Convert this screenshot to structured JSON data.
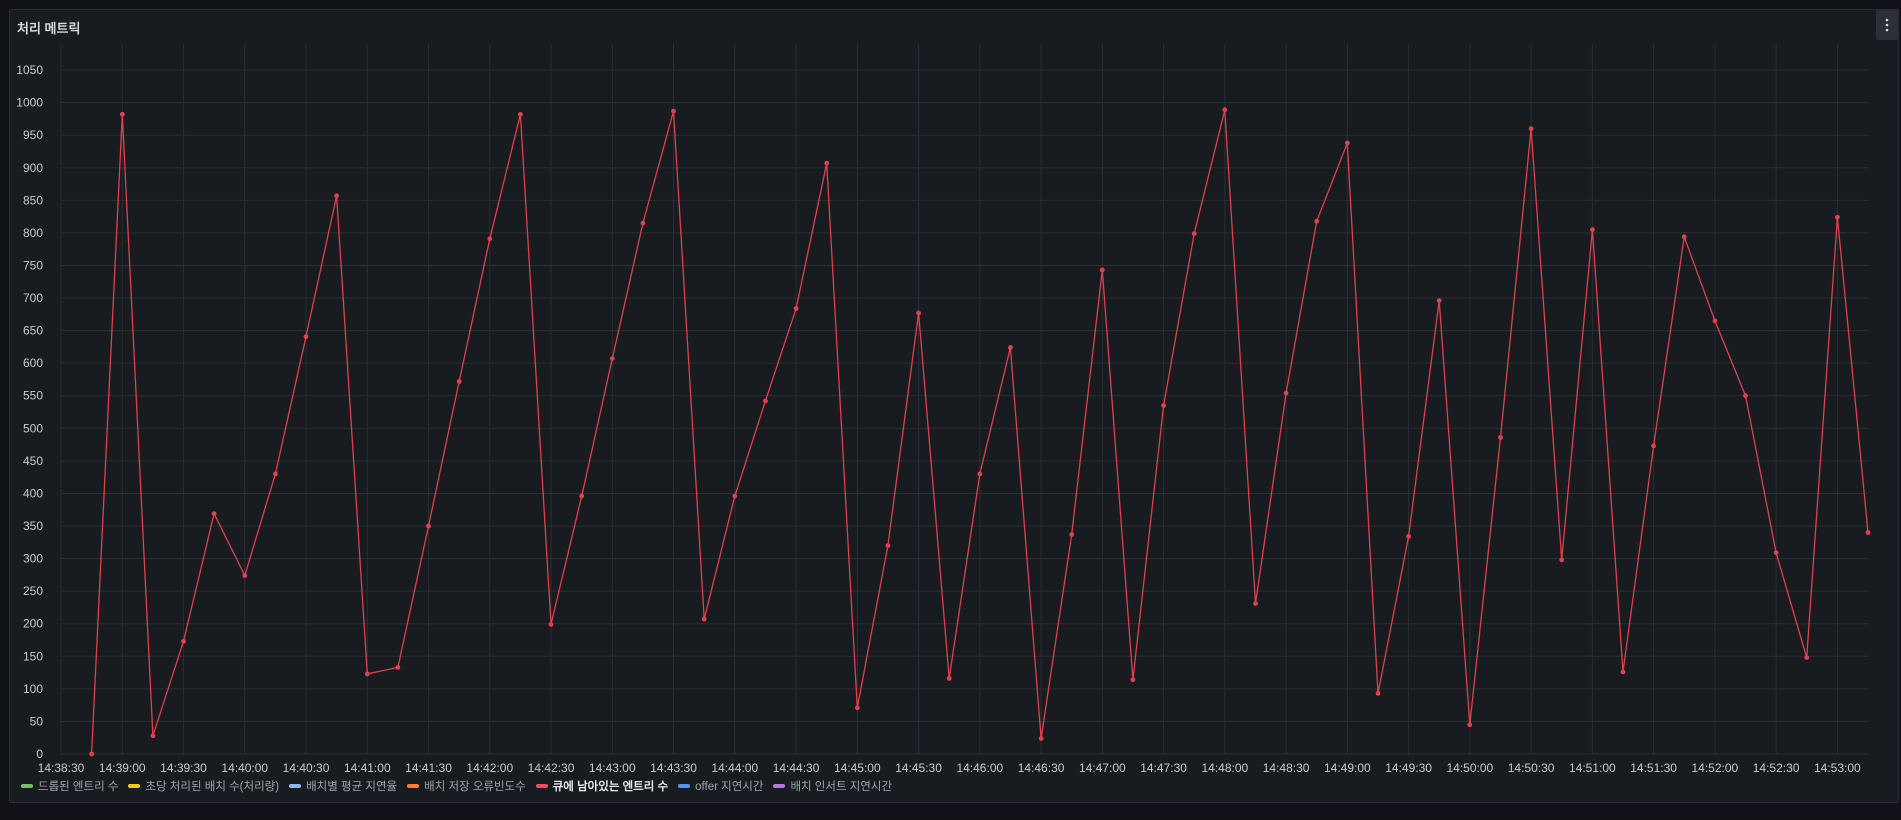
{
  "panel": {
    "title": "처리 메트릭"
  },
  "colors": {
    "line": "#e0414c",
    "grid": "#2b2e33",
    "axis_text": "#cccccc"
  },
  "legend": [
    {
      "label": "드롭된 엔트리 수",
      "color": "#73bf69",
      "active": false
    },
    {
      "label": "초당 처리된 배치 수(처리량)",
      "color": "#f2cc0c",
      "active": false
    },
    {
      "label": "배치별 평균 지연율",
      "color": "#8ab8ff",
      "active": false
    },
    {
      "label": "배치 저장 오류빈도수",
      "color": "#ff7a2e",
      "active": false
    },
    {
      "label": "큐에 남아있는 엔트리 수",
      "color": "#f2495c",
      "active": true
    },
    {
      "label": "offer 지연시간",
      "color": "#5794f2",
      "active": false
    },
    {
      "label": "배치 인서트 지연시간",
      "color": "#b877d9",
      "active": false
    }
  ],
  "chart_data": {
    "type": "line",
    "x_ticks": [
      "14:38:30",
      "14:39:00",
      "14:39:30",
      "14:40:00",
      "14:40:30",
      "14:41:00",
      "14:41:30",
      "14:42:00",
      "14:42:30",
      "14:43:00",
      "14:43:30",
      "14:44:00",
      "14:44:30",
      "14:45:00",
      "14:45:30",
      "14:46:00",
      "14:46:30",
      "14:47:00",
      "14:47:30",
      "14:48:00",
      "14:48:30",
      "14:49:00",
      "14:49:30",
      "14:50:00",
      "14:50:30",
      "14:51:00",
      "14:51:30",
      "14:52:00",
      "14:52:30",
      "14:53:00"
    ],
    "y_ticks": [
      0,
      50,
      100,
      150,
      200,
      250,
      300,
      350,
      400,
      450,
      500,
      550,
      600,
      650,
      700,
      750,
      800,
      850,
      900,
      950,
      1000,
      1050
    ],
    "xlim": [
      "14:38:30",
      "14:53:15"
    ],
    "ylim": [
      0,
      1090
    ],
    "grid": true,
    "legend_position": "bottom-left",
    "series": [
      {
        "name": "큐에 남아있는 엔트리 수",
        "color": "#e0414c",
        "x": [
          "14:38:45",
          "14:39:00",
          "14:39:15",
          "14:39:30",
          "14:39:45",
          "14:40:00",
          "14:40:15",
          "14:40:30",
          "14:40:45",
          "14:41:00",
          "14:41:15",
          "14:41:30",
          "14:41:45",
          "14:42:00",
          "14:42:15",
          "14:42:30",
          "14:42:45",
          "14:43:00",
          "14:43:15",
          "14:43:30",
          "14:43:45",
          "14:44:00",
          "14:44:15",
          "14:44:30",
          "14:44:45",
          "14:45:00",
          "14:45:15",
          "14:45:30",
          "14:45:45",
          "14:46:00",
          "14:46:15",
          "14:46:30",
          "14:46:45",
          "14:47:00",
          "14:47:15",
          "14:47:30",
          "14:47:45",
          "14:48:00",
          "14:48:15",
          "14:48:30",
          "14:48:45",
          "14:49:00",
          "14:49:15",
          "14:49:30",
          "14:49:45",
          "14:50:00",
          "14:50:15",
          "14:50:30",
          "14:50:45",
          "14:51:00",
          "14:51:15",
          "14:51:30",
          "14:51:45",
          "14:52:00",
          "14:52:15",
          "14:52:30",
          "14:52:45",
          "14:53:00",
          "14:53:15"
        ],
        "values": [
          0,
          982,
          28,
          173,
          369,
          274,
          430,
          641,
          857,
          123,
          133,
          350,
          572,
          791,
          982,
          199,
          396,
          607,
          815,
          987,
          207,
          396,
          542,
          684,
          907,
          71,
          320,
          677,
          116,
          430,
          624,
          24,
          337,
          743,
          114,
          535,
          799,
          989,
          231,
          554,
          818,
          938,
          93,
          334,
          696,
          45,
          486,
          960,
          298,
          805,
          126,
          473,
          794,
          665,
          550,
          309,
          148,
          824,
          340
        ]
      }
    ]
  }
}
